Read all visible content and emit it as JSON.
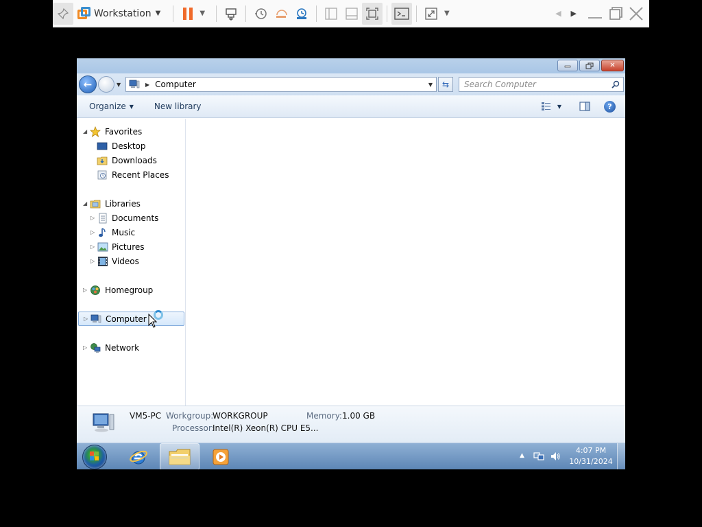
{
  "host": {
    "title": "Workstation"
  },
  "explorer": {
    "address": "Computer",
    "search_placeholder": "Search Computer",
    "toolbar": {
      "organize": "Organize",
      "new_library": "New library"
    },
    "nav": {
      "favorites": "Favorites",
      "desktop": "Desktop",
      "downloads": "Downloads",
      "recent_places": "Recent Places",
      "libraries": "Libraries",
      "documents": "Documents",
      "music": "Music",
      "pictures": "Pictures",
      "videos": "Videos",
      "homegroup": "Homegroup",
      "computer": "Computer",
      "network": "Network"
    },
    "details": {
      "pc_name": "VM5-PC",
      "workgroup_label": "Workgroup:",
      "workgroup_value": "WORKGROUP",
      "memory_label": "Memory:",
      "memory_value": "1.00 GB",
      "processor_label": "Processor:",
      "processor_value": "Intel(R) Xeon(R) CPU E5..."
    }
  },
  "taskbar": {
    "time": "4:07 PM",
    "date": "10/31/2024"
  },
  "colors": {
    "vmware_orange": "#f08a24",
    "pause_orange": "#f06a2a",
    "taskbar_blue": "#6f95c2",
    "selection_border": "#84acdd"
  }
}
